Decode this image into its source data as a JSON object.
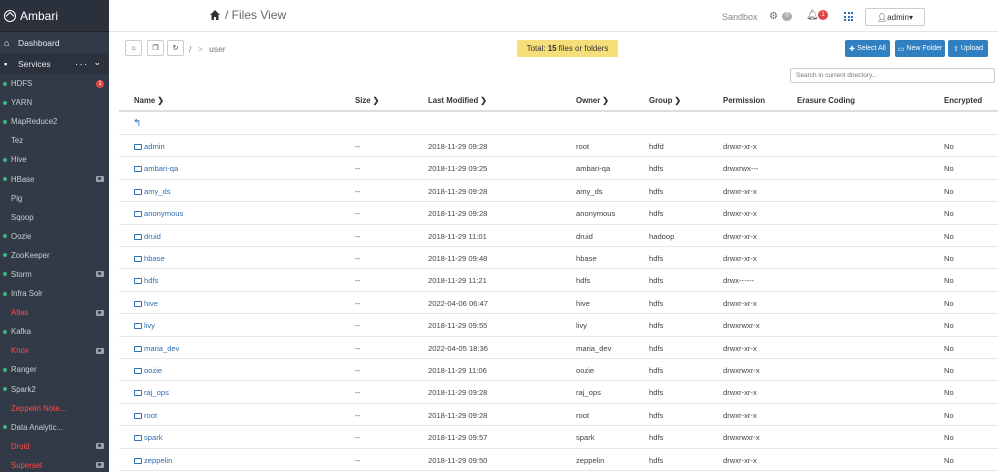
{
  "sidebar": {
    "brand": "Ambari",
    "dashboard": "Dashboard",
    "services_header": "Services",
    "services_menu": "...",
    "items": [
      {
        "label": "HDFS",
        "dot": "green",
        "badge": "1"
      },
      {
        "label": "YARN",
        "dot": "green"
      },
      {
        "label": "MapReduce2",
        "dot": "green"
      },
      {
        "label": "Tez",
        "dot": "none"
      },
      {
        "label": "Hive",
        "dot": "green"
      },
      {
        "label": "HBase",
        "dot": "green",
        "camera": true
      },
      {
        "label": "Pig",
        "dot": "none"
      },
      {
        "label": "Sqoop",
        "dot": "none"
      },
      {
        "label": "Oozie",
        "dot": "green"
      },
      {
        "label": "ZooKeeper",
        "dot": "green"
      },
      {
        "label": "Storm",
        "dot": "green",
        "camera": true
      },
      {
        "label": "Infra Solr",
        "dot": "green"
      },
      {
        "label": "Atlas",
        "dot": "none",
        "red": true,
        "camera": true
      },
      {
        "label": "Kafka",
        "dot": "green"
      },
      {
        "label": "Knox",
        "dot": "none",
        "red": true,
        "camera": true
      },
      {
        "label": "Ranger",
        "dot": "green"
      },
      {
        "label": "Spark2",
        "dot": "green"
      },
      {
        "label": "Zeppelin Note...",
        "dot": "none",
        "red": true
      },
      {
        "label": "Data Analytic...",
        "dot": "green"
      },
      {
        "label": "Druid",
        "dot": "none",
        "red": true,
        "camera": true
      },
      {
        "label": "Superset",
        "dot": "none",
        "red": true,
        "camera": true
      }
    ]
  },
  "topbar": {
    "title": "/ Files View",
    "cluster": "Sandbox",
    "ops_count": "0",
    "alerts_count": "1",
    "user": "admin"
  },
  "toolbar": {
    "root": "/",
    "crumb_sep": ">",
    "path": "user",
    "total_prefix": "Total:",
    "total_count": "15",
    "total_suffix": "files or folders",
    "select_all": "Select All",
    "new_folder": "New Folder",
    "upload": "Upload",
    "search_placeholder": "Search in current directory..."
  },
  "table": {
    "headers": {
      "name": "Name",
      "size": "Size",
      "modified": "Last Modified",
      "owner": "Owner",
      "group": "Group",
      "permission": "Permission",
      "erasure": "Erasure Coding",
      "encrypted": "Encrypted"
    },
    "rows": [
      {
        "name": "admin",
        "size": "--",
        "modified": "2018-11-29 09:28",
        "owner": "root",
        "group": "hdfd",
        "permission": "drwxr-xr-x",
        "encrypted": "No"
      },
      {
        "name": "ambari-qa",
        "size": "--",
        "modified": "2018-11-29 09:25",
        "owner": "ambari-qa",
        "group": "hdfs",
        "permission": "drwxrwx---",
        "encrypted": "No"
      },
      {
        "name": "amy_ds",
        "size": "--",
        "modified": "2018-11-29 09:28",
        "owner": "amy_ds",
        "group": "hdfs",
        "permission": "drwxr-xr-x",
        "encrypted": "No"
      },
      {
        "name": "anonymous",
        "size": "--",
        "modified": "2018-11-29 09:28",
        "owner": "anonymous",
        "group": "hdfs",
        "permission": "drwxr-xr-x",
        "encrypted": "No"
      },
      {
        "name": "druid",
        "size": "--",
        "modified": "2018-11-29 11:01",
        "owner": "druid",
        "group": "hadoop",
        "permission": "drwxr-xr-x",
        "encrypted": "No"
      },
      {
        "name": "hbase",
        "size": "--",
        "modified": "2018-11-29 09:48",
        "owner": "hbase",
        "group": "hdfs",
        "permission": "drwxr-xr-x",
        "encrypted": "No"
      },
      {
        "name": "hdfs",
        "size": "--",
        "modified": "2018-11-29 11:21",
        "owner": "hdfs",
        "group": "hdfs",
        "permission": "drwx------",
        "encrypted": "No"
      },
      {
        "name": "hive",
        "size": "--",
        "modified": "2022-04-06 06:47",
        "owner": "hive",
        "group": "hdfs",
        "permission": "drwxr-xr-x",
        "encrypted": "No"
      },
      {
        "name": "livy",
        "size": "--",
        "modified": "2018-11-29 09:55",
        "owner": "livy",
        "group": "hdfs",
        "permission": "drwxrwxr-x",
        "encrypted": "No"
      },
      {
        "name": "maria_dev",
        "size": "--",
        "modified": "2022-04-05 18:36",
        "owner": "maria_dev",
        "group": "hdfs",
        "permission": "drwxr-xr-x",
        "encrypted": "No"
      },
      {
        "name": "oozie",
        "size": "--",
        "modified": "2018-11-29 11:06",
        "owner": "oozie",
        "group": "hdfs",
        "permission": "drwxrwxr-x",
        "encrypted": "No"
      },
      {
        "name": "raj_ops",
        "size": "--",
        "modified": "2018-11-29 09:28",
        "owner": "raj_ops",
        "group": "hdfs",
        "permission": "drwxr-xr-x",
        "encrypted": "No"
      },
      {
        "name": "root",
        "size": "--",
        "modified": "2018-11-29 09:28",
        "owner": "root",
        "group": "hdfs",
        "permission": "drwxr-xr-x",
        "encrypted": "No"
      },
      {
        "name": "spark",
        "size": "--",
        "modified": "2018-11-29 09:57",
        "owner": "spark",
        "group": "hdfs",
        "permission": "drwxrwxr-x",
        "encrypted": "No"
      },
      {
        "name": "zeppelin",
        "size": "--",
        "modified": "2018-11-29 09:50",
        "owner": "zeppelin",
        "group": "hdfs",
        "permission": "drwxr-xr-x",
        "encrypted": "No"
      }
    ]
  }
}
